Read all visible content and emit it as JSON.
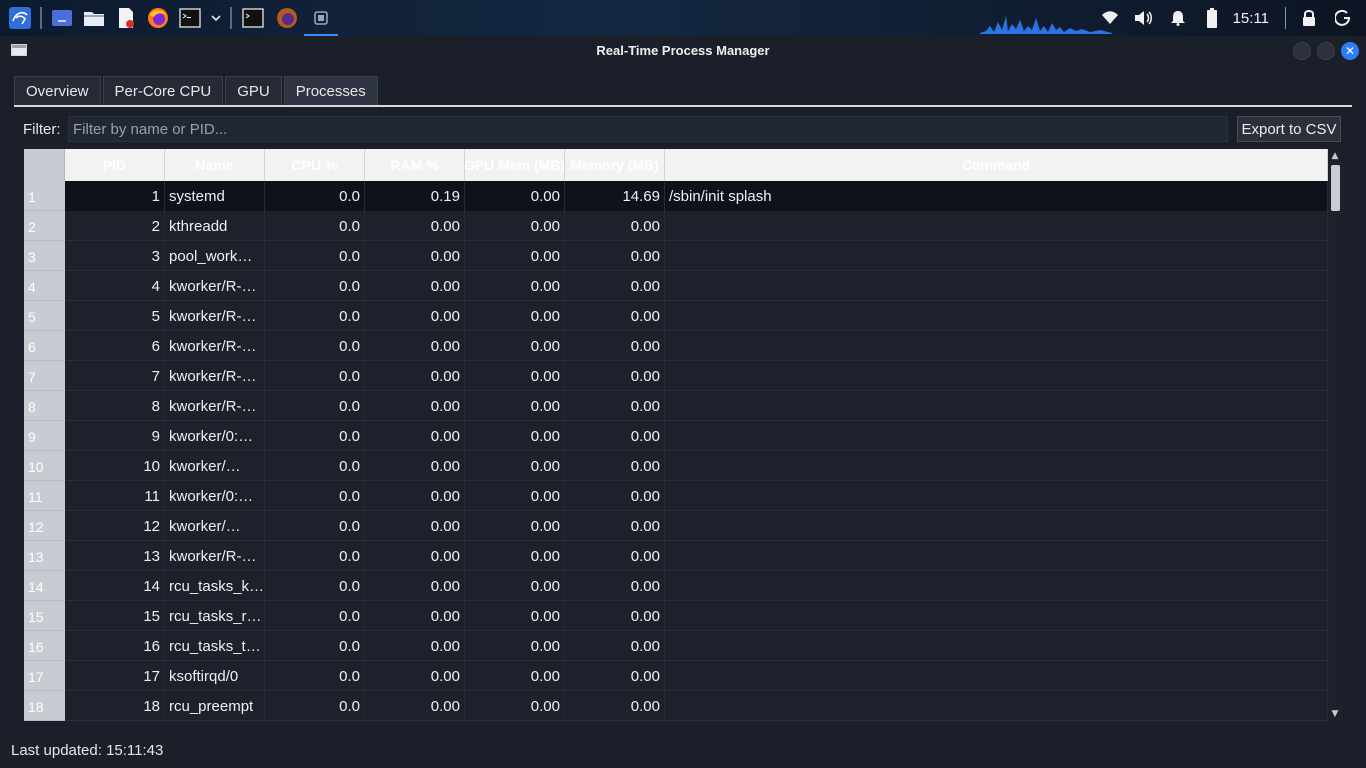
{
  "taskbar": {
    "clock": "15:11",
    "icons": [
      "kali-menu-icon",
      "desktop-icon",
      "files-icon",
      "text-editor-icon",
      "firefox-icon",
      "terminal-icon",
      "dropdown-icon",
      "terminal-window-icon",
      "firefox-window-icon",
      "app-window-icon"
    ],
    "tray": [
      "wifi-icon",
      "volume-icon",
      "bell-icon",
      "battery-icon",
      "lock-icon",
      "power-icon"
    ]
  },
  "window": {
    "title": "Real-Time Process Manager"
  },
  "tabs": [
    {
      "label": "Overview"
    },
    {
      "label": "Per-Core CPU"
    },
    {
      "label": "GPU"
    },
    {
      "label": "Processes"
    }
  ],
  "filter": {
    "label": "Filter:",
    "placeholder": "Filter by name or PID...",
    "value": ""
  },
  "export_button": "Export to CSV",
  "table": {
    "columns": [
      "PID",
      "Name",
      "CPU %",
      "RAM %",
      "GPU Mem (MB)",
      "Memory (MB)",
      "Command"
    ],
    "rows": [
      {
        "n": "1",
        "pid": "1",
        "name": "systemd",
        "cpu": "0.0",
        "ram": "0.19",
        "gpu": "0.00",
        "mem": "14.69",
        "cmd": "/sbin/init splash"
      },
      {
        "n": "2",
        "pid": "2",
        "name": "kthreadd",
        "cpu": "0.0",
        "ram": "0.00",
        "gpu": "0.00",
        "mem": "0.00",
        "cmd": ""
      },
      {
        "n": "3",
        "pid": "3",
        "name": "pool_work…",
        "cpu": "0.0",
        "ram": "0.00",
        "gpu": "0.00",
        "mem": "0.00",
        "cmd": ""
      },
      {
        "n": "4",
        "pid": "4",
        "name": "kworker/R-…",
        "cpu": "0.0",
        "ram": "0.00",
        "gpu": "0.00",
        "mem": "0.00",
        "cmd": ""
      },
      {
        "n": "5",
        "pid": "5",
        "name": "kworker/R-…",
        "cpu": "0.0",
        "ram": "0.00",
        "gpu": "0.00",
        "mem": "0.00",
        "cmd": ""
      },
      {
        "n": "6",
        "pid": "6",
        "name": "kworker/R-…",
        "cpu": "0.0",
        "ram": "0.00",
        "gpu": "0.00",
        "mem": "0.00",
        "cmd": ""
      },
      {
        "n": "7",
        "pid": "7",
        "name": "kworker/R-…",
        "cpu": "0.0",
        "ram": "0.00",
        "gpu": "0.00",
        "mem": "0.00",
        "cmd": ""
      },
      {
        "n": "8",
        "pid": "8",
        "name": "kworker/R-…",
        "cpu": "0.0",
        "ram": "0.00",
        "gpu": "0.00",
        "mem": "0.00",
        "cmd": ""
      },
      {
        "n": "9",
        "pid": "9",
        "name": "kworker/0:…",
        "cpu": "0.0",
        "ram": "0.00",
        "gpu": "0.00",
        "mem": "0.00",
        "cmd": ""
      },
      {
        "n": "10",
        "pid": "10",
        "name": "kworker/…",
        "cpu": "0.0",
        "ram": "0.00",
        "gpu": "0.00",
        "mem": "0.00",
        "cmd": ""
      },
      {
        "n": "11",
        "pid": "11",
        "name": "kworker/0:…",
        "cpu": "0.0",
        "ram": "0.00",
        "gpu": "0.00",
        "mem": "0.00",
        "cmd": ""
      },
      {
        "n": "12",
        "pid": "12",
        "name": "kworker/…",
        "cpu": "0.0",
        "ram": "0.00",
        "gpu": "0.00",
        "mem": "0.00",
        "cmd": ""
      },
      {
        "n": "13",
        "pid": "13",
        "name": "kworker/R-…",
        "cpu": "0.0",
        "ram": "0.00",
        "gpu": "0.00",
        "mem": "0.00",
        "cmd": ""
      },
      {
        "n": "14",
        "pid": "14",
        "name": "rcu_tasks_k…",
        "cpu": "0.0",
        "ram": "0.00",
        "gpu": "0.00",
        "mem": "0.00",
        "cmd": ""
      },
      {
        "n": "15",
        "pid": "15",
        "name": "rcu_tasks_r…",
        "cpu": "0.0",
        "ram": "0.00",
        "gpu": "0.00",
        "mem": "0.00",
        "cmd": ""
      },
      {
        "n": "16",
        "pid": "16",
        "name": "rcu_tasks_t…",
        "cpu": "0.0",
        "ram": "0.00",
        "gpu": "0.00",
        "mem": "0.00",
        "cmd": ""
      },
      {
        "n": "17",
        "pid": "17",
        "name": "ksoftirqd/0",
        "cpu": "0.0",
        "ram": "0.00",
        "gpu": "0.00",
        "mem": "0.00",
        "cmd": ""
      },
      {
        "n": "18",
        "pid": "18",
        "name": "rcu_preempt",
        "cpu": "0.0",
        "ram": "0.00",
        "gpu": "0.00",
        "mem": "0.00",
        "cmd": ""
      }
    ]
  },
  "status": "Last updated: 15:11:43",
  "colors": {
    "accent": "#2f7cf6",
    "background": "#1b1f2a"
  }
}
